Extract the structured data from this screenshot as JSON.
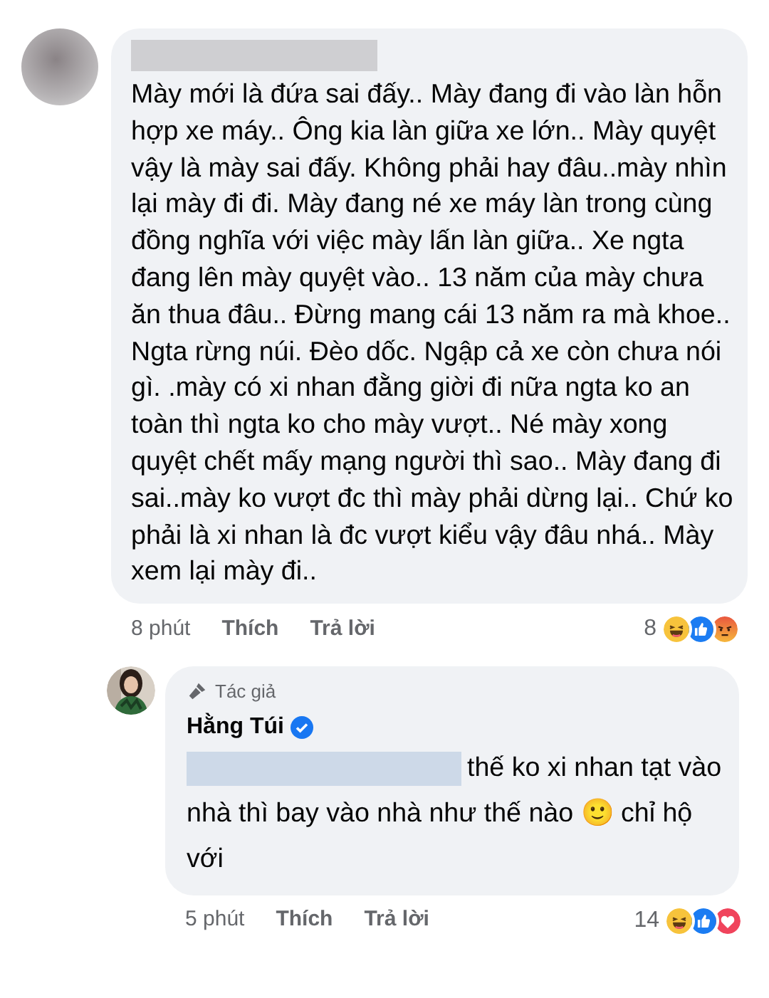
{
  "comments": [
    {
      "name_redacted": true,
      "text": "Mày mới là đứa sai đấy.. Mày đang đi vào làn hỗn hợp xe máy.. Ông kia làn giữa xe lớn.. Mày quyệt vậy là mày sai đấy. Không phải hay đâu..mày nhìn lại mày đi đi. Mày đang né xe máy làn trong cùng đồng nghĩa với việc mày lấn làn giữa.. Xe ngta đang lên mày quyệt vào.. 13 năm của mày chưa ăn thua đâu.. Đừng mang cái 13 năm ra mà khoe.. Ngta rừng núi. Đèo dốc. Ngập cả xe còn chưa nói gì. .mày có xi nhan đằng giời đi nữa ngta ko an toàn thì ngta ko cho mày vượt.. Né mày xong quyệt chết mấy mạng người thì sao.. Mày đang đi sai..mày ko vượt đc thì mày phải dừng lại.. Chứ ko phải là xi nhan là đc vượt kiểu vậy đâu nhá.. Mày xem lại mày đi..",
      "time": "8 phút",
      "like": "Thích",
      "reply": "Trả lời",
      "reaction_count": "8",
      "reactions": [
        {
          "kind": "haha"
        },
        {
          "kind": "like"
        },
        {
          "kind": "angry"
        }
      ],
      "replies": [
        {
          "badge": "Tác giả",
          "name": "Hằng Túi",
          "verified": true,
          "mention_redacted": true,
          "text": "thế ko xi nhan tạt vào nhà thì bay vào nhà như thế nào 🙂 chỉ hộ với",
          "time": "5 phút",
          "like": "Thích",
          "reply": "Trả lời",
          "reaction_count": "14",
          "reactions": [
            {
              "kind": "haha"
            },
            {
              "kind": "like"
            },
            {
              "kind": "love"
            }
          ]
        }
      ]
    }
  ]
}
